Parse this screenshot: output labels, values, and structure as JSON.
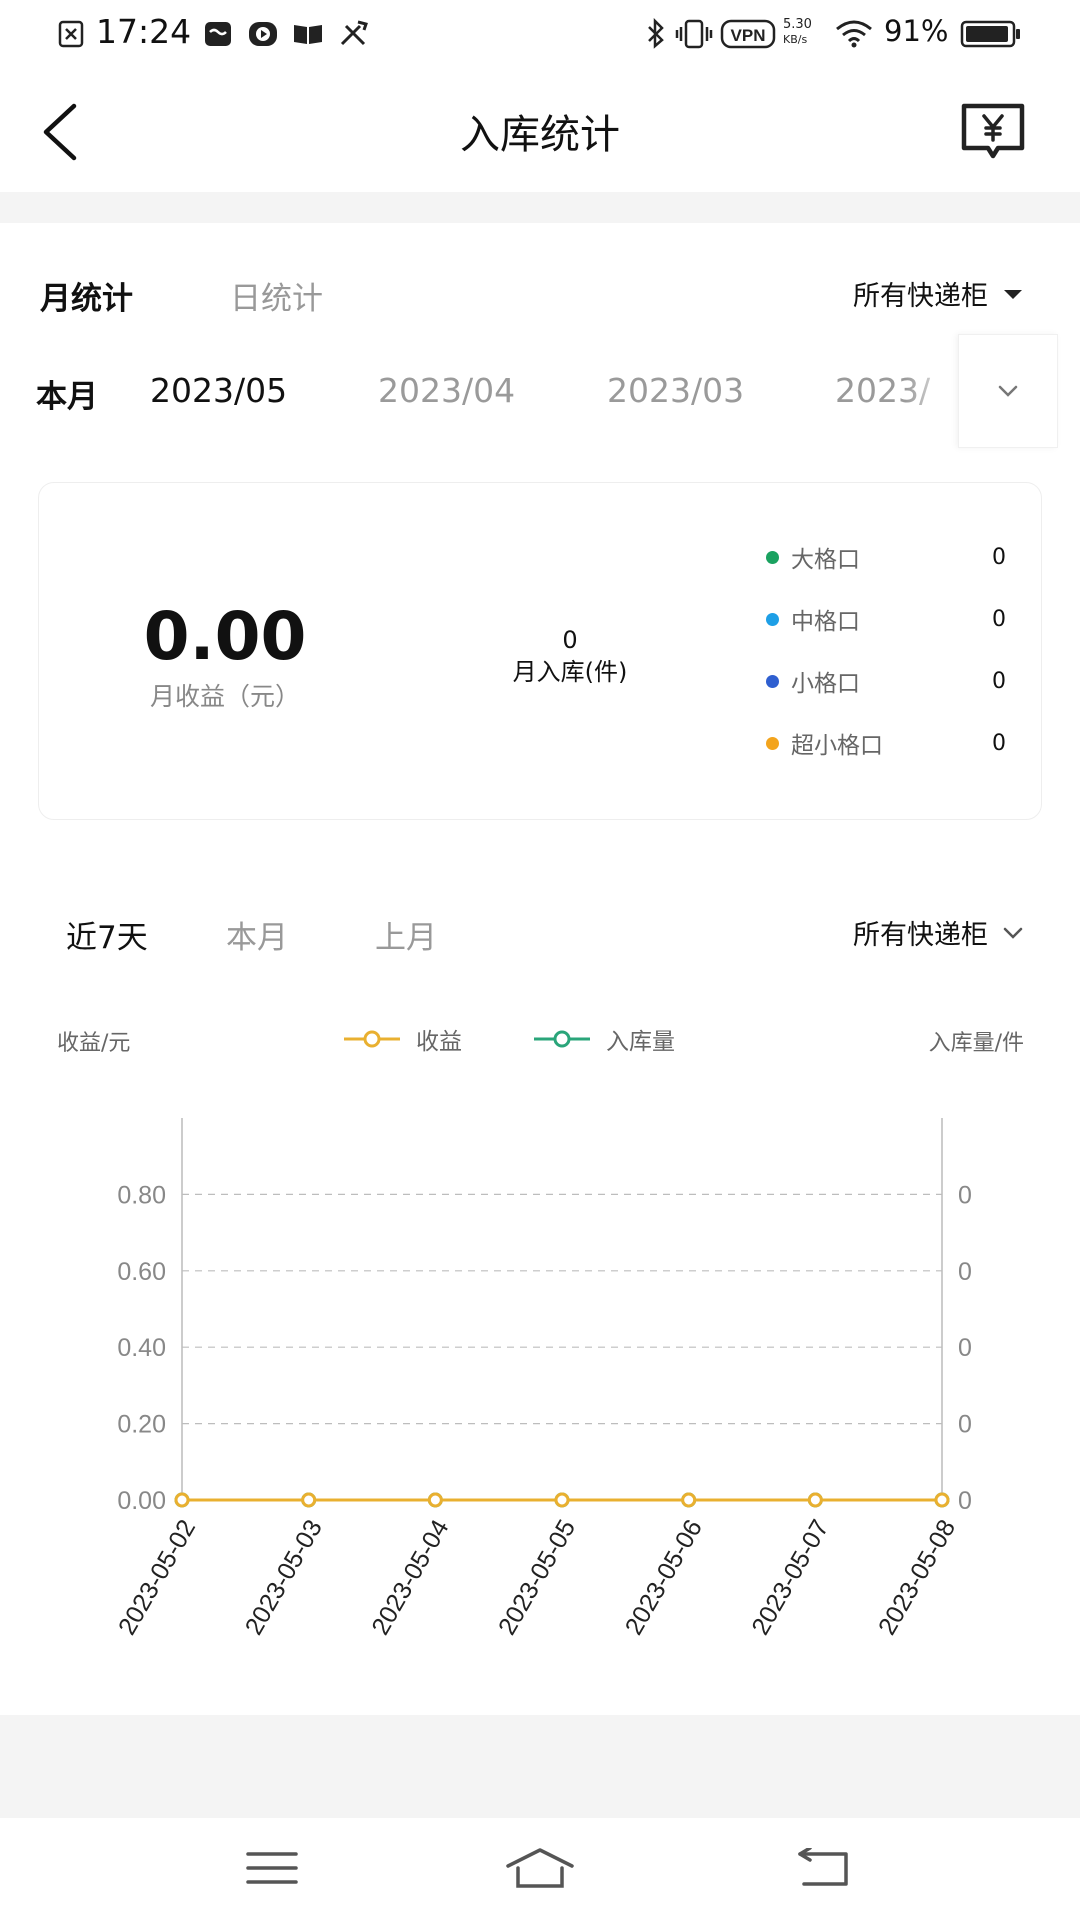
{
  "status_bar": {
    "time": "17:24",
    "network_speed": "5.30",
    "network_unit": "KB/s",
    "vpn": "VPN",
    "battery": "91%",
    "icons": [
      "image-close-icon",
      "mask-icon",
      "play-icon",
      "book-icon",
      "tools-icon",
      "bluetooth-icon",
      "vibrate-icon",
      "vpn-icon",
      "wifi-icon",
      "battery-icon"
    ]
  },
  "header": {
    "title": "入库统计",
    "back_icon": "back-arrow-icon",
    "wallet_icon": "wallet-yen-icon"
  },
  "tabs": {
    "monthly": "月统计",
    "daily": "日统计",
    "locker_filter": "所有快递柜"
  },
  "months": {
    "label": "本月",
    "items": [
      "2023/05",
      "2023/04",
      "2023/03",
      "2023/"
    ],
    "selected": "2023/05"
  },
  "summary": {
    "income_value": "0.00",
    "income_label": "月收益（元）",
    "inbound_value": "0",
    "inbound_label": "月入库(件)",
    "slots": [
      {
        "name": "大格口",
        "count": "0",
        "color": "#1aa260"
      },
      {
        "name": "中格口",
        "count": "0",
        "color": "#1e9fe6"
      },
      {
        "name": "小格口",
        "count": "0",
        "color": "#2f5fd0"
      },
      {
        "name": "超小格口",
        "count": "0",
        "color": "#f3a41d"
      }
    ]
  },
  "chart_tabs": {
    "items": [
      "近7天",
      "本月",
      "上月"
    ],
    "selected": "近7天",
    "locker_filter": "所有快递柜"
  },
  "chart_data": {
    "type": "line",
    "title": "",
    "x": [
      "2023-05-02",
      "2023-05-03",
      "2023-05-04",
      "2023-05-05",
      "2023-05-06",
      "2023-05-07",
      "2023-05-08"
    ],
    "y_left_label": "收益/元",
    "y_right_label": "入库量/件",
    "y_left_ticks": [
      "0.00",
      "0.20",
      "0.40",
      "0.60",
      "0.80"
    ],
    "y_right_ticks": [
      "0",
      "0",
      "0",
      "0",
      "0"
    ],
    "ylim": [
      0,
      1
    ],
    "grid": true,
    "legend_placement": "top-center",
    "series": [
      {
        "name": "收益",
        "values": [
          0,
          0,
          0,
          0,
          0,
          0,
          0
        ],
        "color": "#e9b030"
      },
      {
        "name": "入库量",
        "values": [
          0,
          0,
          0,
          0,
          0,
          0,
          0
        ],
        "color": "#2aa57a"
      }
    ]
  },
  "navbar": {
    "icons": [
      "menu-icon",
      "home-icon",
      "back-icon"
    ]
  }
}
